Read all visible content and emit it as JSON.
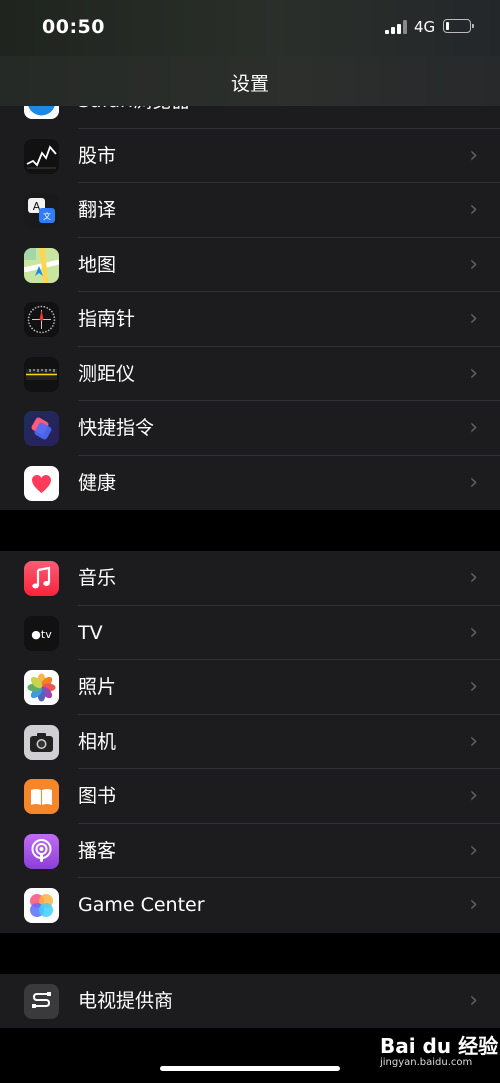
{
  "status_bar": {
    "time": "00:50",
    "network": "4G",
    "battery_level": 0.15
  },
  "nav": {
    "title": "设置"
  },
  "groups": [
    [
      {
        "label": "Safari浏览器",
        "icon": "safari-icon"
      },
      {
        "label": "股市",
        "icon": "stocks-icon"
      },
      {
        "label": "翻译",
        "icon": "translate-icon"
      },
      {
        "label": "地图",
        "icon": "maps-icon"
      },
      {
        "label": "指南针",
        "icon": "compass-icon"
      },
      {
        "label": "测距仪",
        "icon": "measure-icon"
      },
      {
        "label": "快捷指令",
        "icon": "shortcuts-icon"
      },
      {
        "label": "健康",
        "icon": "health-icon"
      }
    ],
    [
      {
        "label": "音乐",
        "icon": "music-icon"
      },
      {
        "label": "TV",
        "icon": "apple-tv-icon"
      },
      {
        "label": "照片",
        "icon": "photos-icon"
      },
      {
        "label": "相机",
        "icon": "camera-icon"
      },
      {
        "label": "图书",
        "icon": "books-icon"
      },
      {
        "label": "播客",
        "icon": "podcasts-icon"
      },
      {
        "label": "Game Center",
        "icon": "game-center-icon"
      }
    ],
    [
      {
        "label": "电视提供商",
        "icon": "tv-provider-icon"
      }
    ]
  ],
  "watermark": {
    "logo_text": "Bai du 经验",
    "url": "jingyan.baidu.com"
  }
}
